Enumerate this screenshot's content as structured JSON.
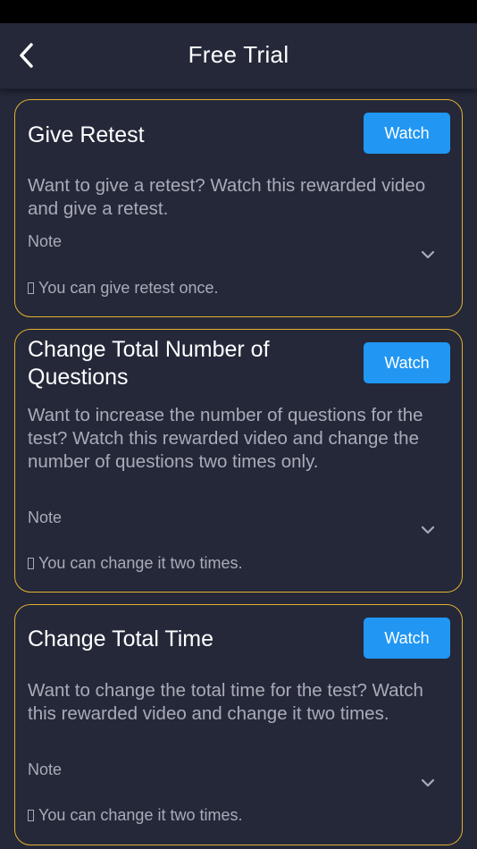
{
  "header": {
    "title": "Free Trial",
    "back_icon": "chevron-left-icon"
  },
  "colors": {
    "background": "#242839",
    "card_border": "#e4b12f",
    "button": "#2196f3",
    "muted_text": "#a9acb7"
  },
  "cards": [
    {
      "title": "Give Retest",
      "button_label": "Watch",
      "description": "Want to give a retest? Watch this rewarded video and give a retest.",
      "note_label": "Note",
      "note_text": "You can give retest once."
    },
    {
      "title": "Change Total Number of Questions",
      "button_label": "Watch",
      "description": "Want to increase the number of questions for the test? Watch this rewarded video and change the number of questions two times only.",
      "note_label": "Note",
      "note_text": "You can change it two times."
    },
    {
      "title": "Change Total Time",
      "button_label": "Watch",
      "description": "Want to change the total time for the test? Watch this rewarded video and change it two times.",
      "note_label": "Note",
      "note_text": "You can change it two times."
    }
  ]
}
